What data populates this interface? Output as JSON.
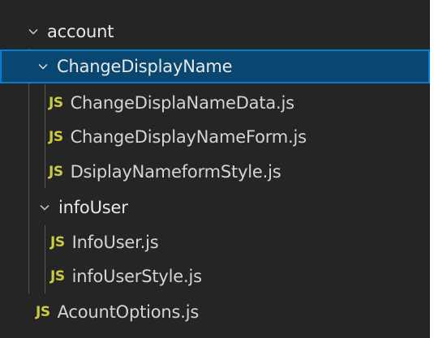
{
  "explorer": {
    "partial_label": "",
    "tree": [
      {
        "kind": "folder",
        "label": "account",
        "expanded": true,
        "depth": 0
      },
      {
        "kind": "folder",
        "label": "ChangeDisplayName",
        "expanded": true,
        "depth": 1,
        "selected": true
      },
      {
        "kind": "file",
        "label": "ChangeDisplaNameData.js",
        "icon": "JS",
        "depth": 2
      },
      {
        "kind": "file",
        "label": "ChangeDisplayNameForm.js",
        "icon": "JS",
        "depth": 2
      },
      {
        "kind": "file",
        "label": "DsiplayNameformStyle.js",
        "icon": "JS",
        "depth": 2
      },
      {
        "kind": "folder",
        "label": "infoUser",
        "expanded": true,
        "depth": 1
      },
      {
        "kind": "file",
        "label": "InfoUser.js",
        "icon": "JS",
        "depth": 2
      },
      {
        "kind": "file",
        "label": "infoUserStyle.js",
        "icon": "JS",
        "depth": 2
      },
      {
        "kind": "file",
        "label": "AcountOptions.js",
        "icon": "JS",
        "depth": 1
      }
    ]
  },
  "colors": {
    "background": "#252526",
    "selection_background": "#094771",
    "selection_border": "#0a7bd4",
    "js_icon": "#cbcb41",
    "text": "#cccccc",
    "indent_guide": "#585858"
  },
  "icons": {
    "chevron": "chevron-down-icon",
    "js": "javascript-file-icon"
  }
}
